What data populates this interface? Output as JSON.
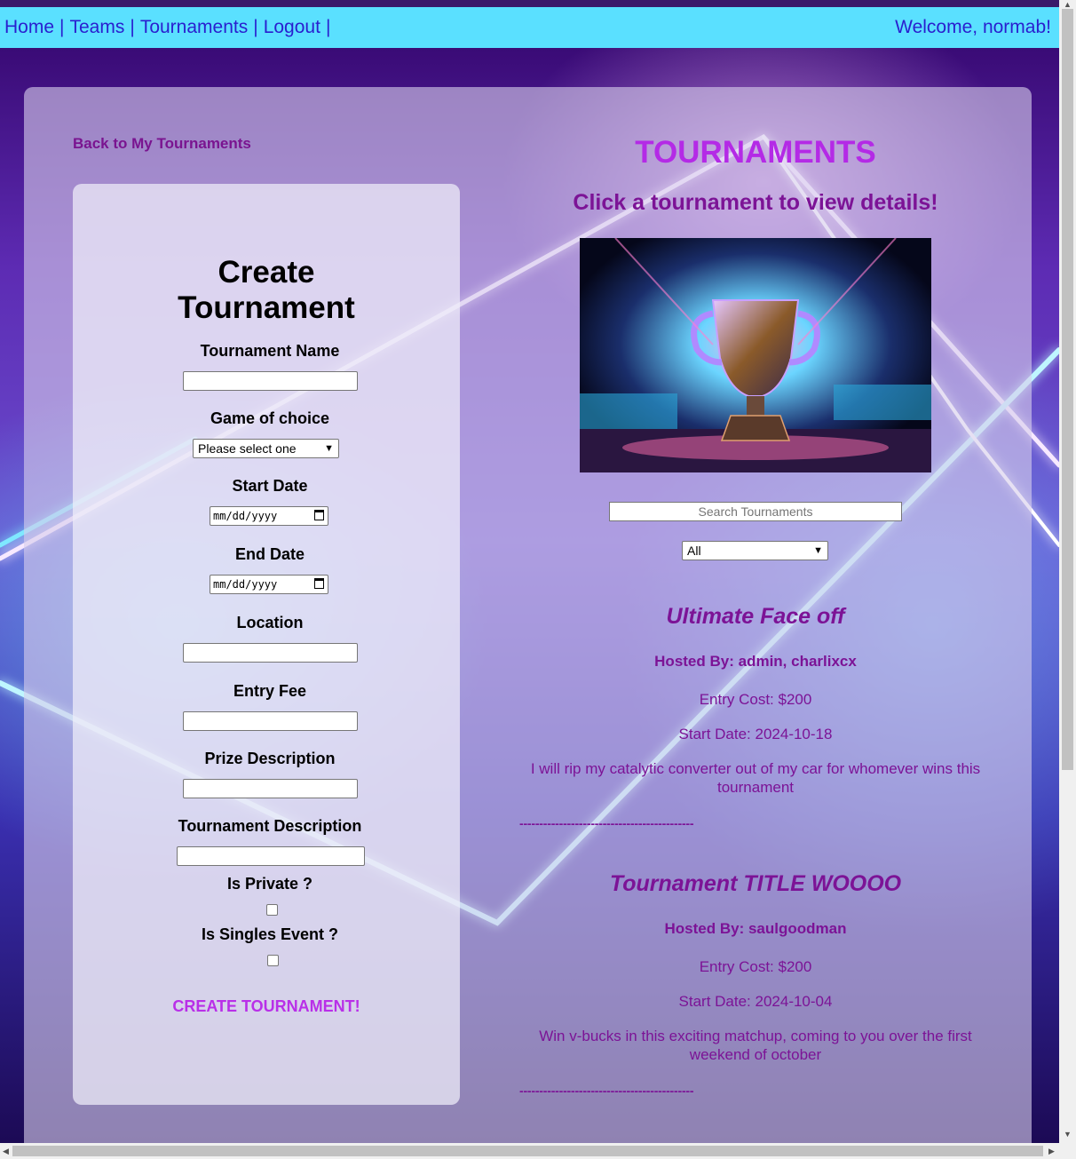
{
  "nav": {
    "links": [
      "Home",
      "Teams",
      "Tournaments",
      "Logout"
    ],
    "separator": "|",
    "welcome": "Welcome, normab!"
  },
  "back_link": "Back to My Tournaments",
  "form": {
    "title": "Create\nTournament",
    "fields": {
      "name_label": "Tournament Name",
      "game_label": "Game of choice",
      "game_selected": "Please select one",
      "start_label": "Start Date",
      "start_placeholder": "mm/dd/yyyy",
      "end_label": "End Date",
      "end_placeholder": "mm/dd/yyyy",
      "location_label": "Location",
      "fee_label": "Entry Fee",
      "prize_label": "Prize Description",
      "desc_label": "Tournament Description",
      "private_label": "Is Private ?",
      "singles_label": "Is Singles Event ?"
    },
    "submit": "CREATE TOURNAMENT!"
  },
  "list": {
    "heading": "TOURNAMENTS",
    "subheading": "Click a tournament to view details!",
    "search_placeholder": "Search Tournaments",
    "filter_selected": "All",
    "divider": "--------------------------------------------",
    "tournaments": [
      {
        "title": "Ultimate Face off",
        "host": "Hosted By: admin, charlixcx",
        "cost": "Entry Cost: $200",
        "start": "Start Date: 2024-10-18",
        "description": "I will rip my catalytic converter out of my car for whomever wins this tournament"
      },
      {
        "title": "Tournament TITLE WOOOO",
        "host": "Hosted By: saulgoodman",
        "cost": "Entry Cost: $200",
        "start": "Start Date: 2024-10-04",
        "description": "Win v-bucks in this exciting matchup, coming to you over the first weekend of october"
      }
    ]
  },
  "colors": {
    "navbar": "#5ae0ff",
    "nav_text": "#2a1fcf",
    "heading": "#b42ae6",
    "accent_text": "#7c1396",
    "submit": "#b92fe8"
  }
}
